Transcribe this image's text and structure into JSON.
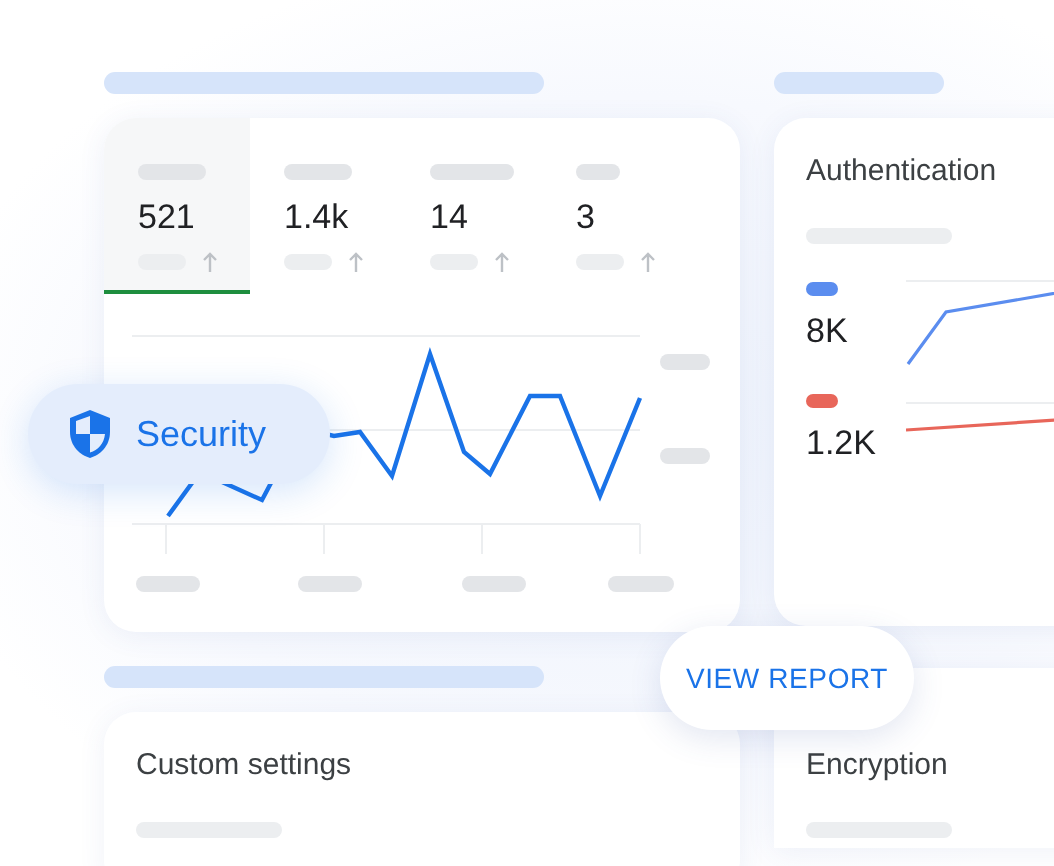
{
  "metrics_card": {
    "tabs": [
      {
        "value": "521",
        "selected": true
      },
      {
        "value": "1.4k",
        "selected": false
      },
      {
        "value": "14",
        "selected": false
      },
      {
        "value": "3",
        "selected": false
      }
    ]
  },
  "security_chip": {
    "label": "Security"
  },
  "authentication_card": {
    "title": "Authentication",
    "series": [
      {
        "value": "8K",
        "color": "#5b8def"
      },
      {
        "value": "1.2K",
        "color": "#e8665a"
      }
    ]
  },
  "view_report_button": {
    "label": "VIEW REPORT"
  },
  "custom_settings_card": {
    "title": "Custom settings"
  },
  "encryption_card": {
    "title": "Encryption"
  }
}
